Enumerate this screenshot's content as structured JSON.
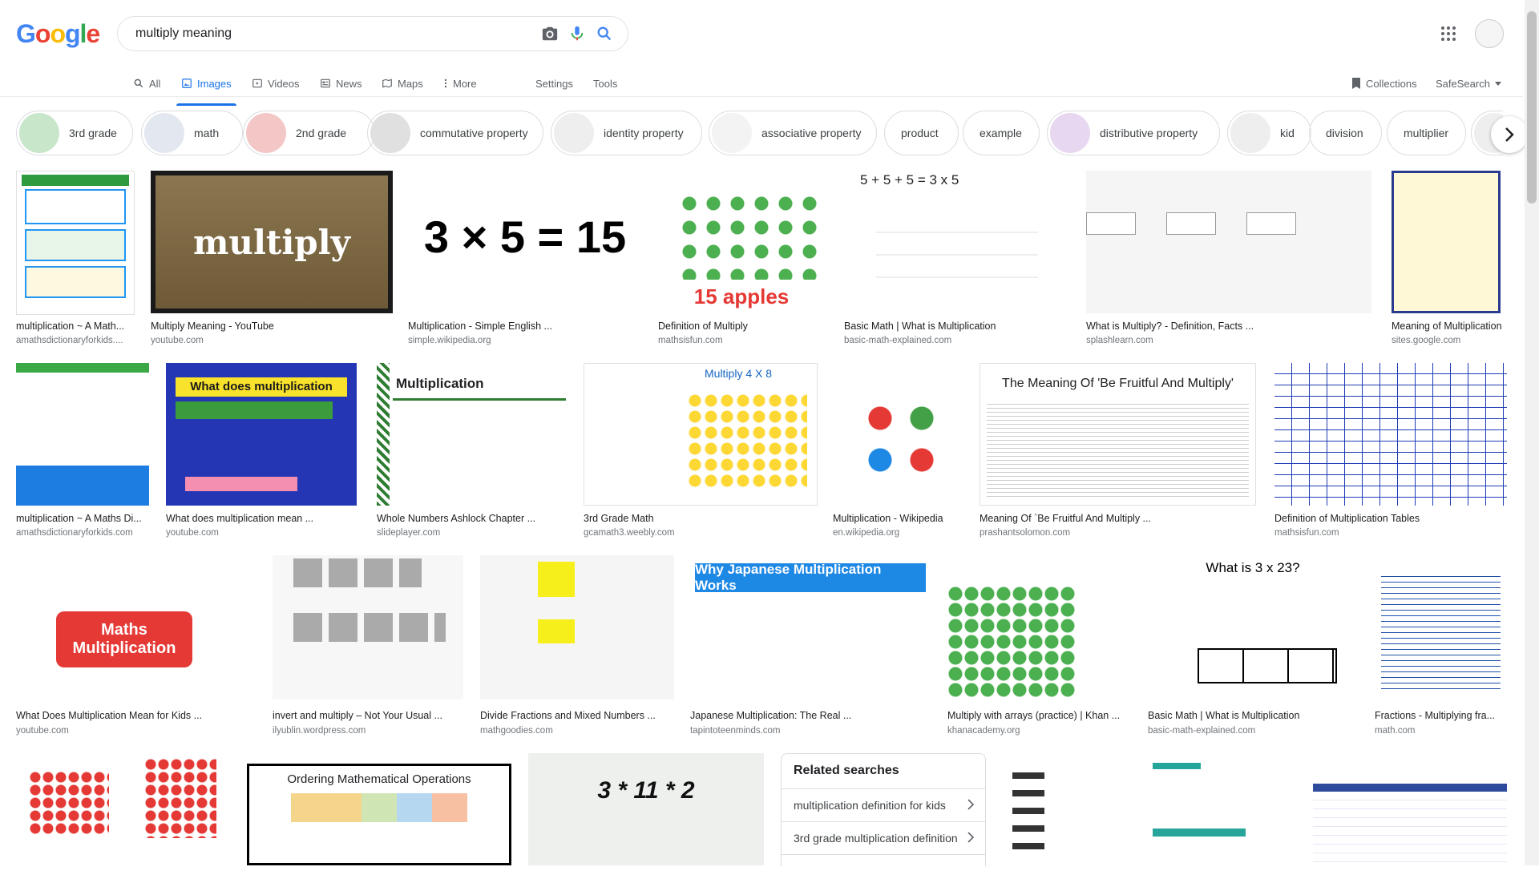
{
  "logo": [
    "G",
    "o",
    "o",
    "g",
    "l",
    "e"
  ],
  "search": {
    "value": "multiply meaning"
  },
  "tabs": [
    {
      "label": "All",
      "icon": "search-icon"
    },
    {
      "label": "Images",
      "icon": "image-icon",
      "active": true
    },
    {
      "label": "Videos",
      "icon": "video-icon"
    },
    {
      "label": "News",
      "icon": "news-icon"
    },
    {
      "label": "Maps",
      "icon": "map-icon"
    },
    {
      "label": "More",
      "icon": "more-vertical-icon"
    }
  ],
  "tools": {
    "settings": "Settings",
    "tools": "Tools",
    "collections": "Collections",
    "safesearch": "SafeSearch"
  },
  "chips": [
    "3rd grade",
    "math",
    "2nd grade",
    "commutative property",
    "identity property",
    "associative property",
    "product",
    "example",
    "distributive property",
    "kid",
    "division",
    "multiplier"
  ],
  "results": [
    {
      "title": "multiplication ~ A Math...",
      "source": "amathsdictionaryforkids...."
    },
    {
      "title": "Multiply Meaning - YouTube",
      "source": "youtube.com",
      "img_text": "multiply"
    },
    {
      "title": "Multiplication - Simple English ...",
      "source": "simple.wikipedia.org",
      "img_text": "3 × 5 = 15"
    },
    {
      "title": "Definition of Multiply",
      "source": "mathsisfun.com",
      "img_text": "15 apples"
    },
    {
      "title": "Basic Math | What is Multiplication",
      "source": "basic-math-explained.com",
      "img_text": "5 + 5 + 5 = 3 x 5"
    },
    {
      "title": "What is Multiply? - Definition, Facts ...",
      "source": "splashlearn.com"
    },
    {
      "title": "Meaning of Multiplication",
      "source": "sites.google.com"
    },
    {
      "title": "multiplication ~ A Maths Di...",
      "source": "amathsdictionaryforkids.com"
    },
    {
      "title": "What does multiplication mean ...",
      "source": "youtube.com",
      "img_text": "What does multiplication mean?"
    },
    {
      "title": "Whole Numbers Ashlock Chapter ...",
      "source": "slideplayer.com",
      "img_text": "Multiplication"
    },
    {
      "title": "3rd Grade Math",
      "source": "gcamath3.weebly.com",
      "img_text": "Multiply 4 X 8"
    },
    {
      "title": "Multiplication - Wikipedia",
      "source": "en.wikipedia.org"
    },
    {
      "title": "Meaning Of `Be Fruitful And Multiply ...",
      "source": "prashantsolomon.com",
      "img_text": "The Meaning Of 'Be Fruitful And Multiply'"
    },
    {
      "title": "Definition of Multiplication Tables",
      "source": "mathsisfun.com"
    },
    {
      "title": "What Does Multiplication Mean for Kids ...",
      "source": "youtube.com",
      "img_text": "Maths Multiplication"
    },
    {
      "title": "invert and multiply – Not Your Usual ...",
      "source": "ilyublin.wordpress.com"
    },
    {
      "title": "Divide Fractions and Mixed Numbers ...",
      "source": "mathgoodies.com"
    },
    {
      "title": "Japanese Multiplication: The Real ...",
      "source": "tapintoteenminds.com",
      "img_text": "Why Japanese Multiplication Works"
    },
    {
      "title": "Multiply with arrays (practice) | Khan ...",
      "source": "khanacademy.org"
    },
    {
      "title": "Basic Math | What is Multiplication",
      "source": "basic-math-explained.com",
      "img_text": "What is 3 x 23?"
    },
    {
      "title": "Fractions - Multiplying fra...",
      "source": "math.com"
    },
    {
      "title": "",
      "source": ""
    },
    {
      "title": "",
      "source": "",
      "img_text": "Ordering Mathematical Operations"
    },
    {
      "title": "",
      "source": "",
      "img_text": "3 * 11 * 2"
    },
    {
      "title": "",
      "source": ""
    },
    {
      "title": "",
      "source": ""
    },
    {
      "title": "",
      "source": ""
    }
  ],
  "related": {
    "heading": "Related searches",
    "items": [
      "multiplication definition for kids",
      "3rd grade multiplication definition"
    ]
  }
}
